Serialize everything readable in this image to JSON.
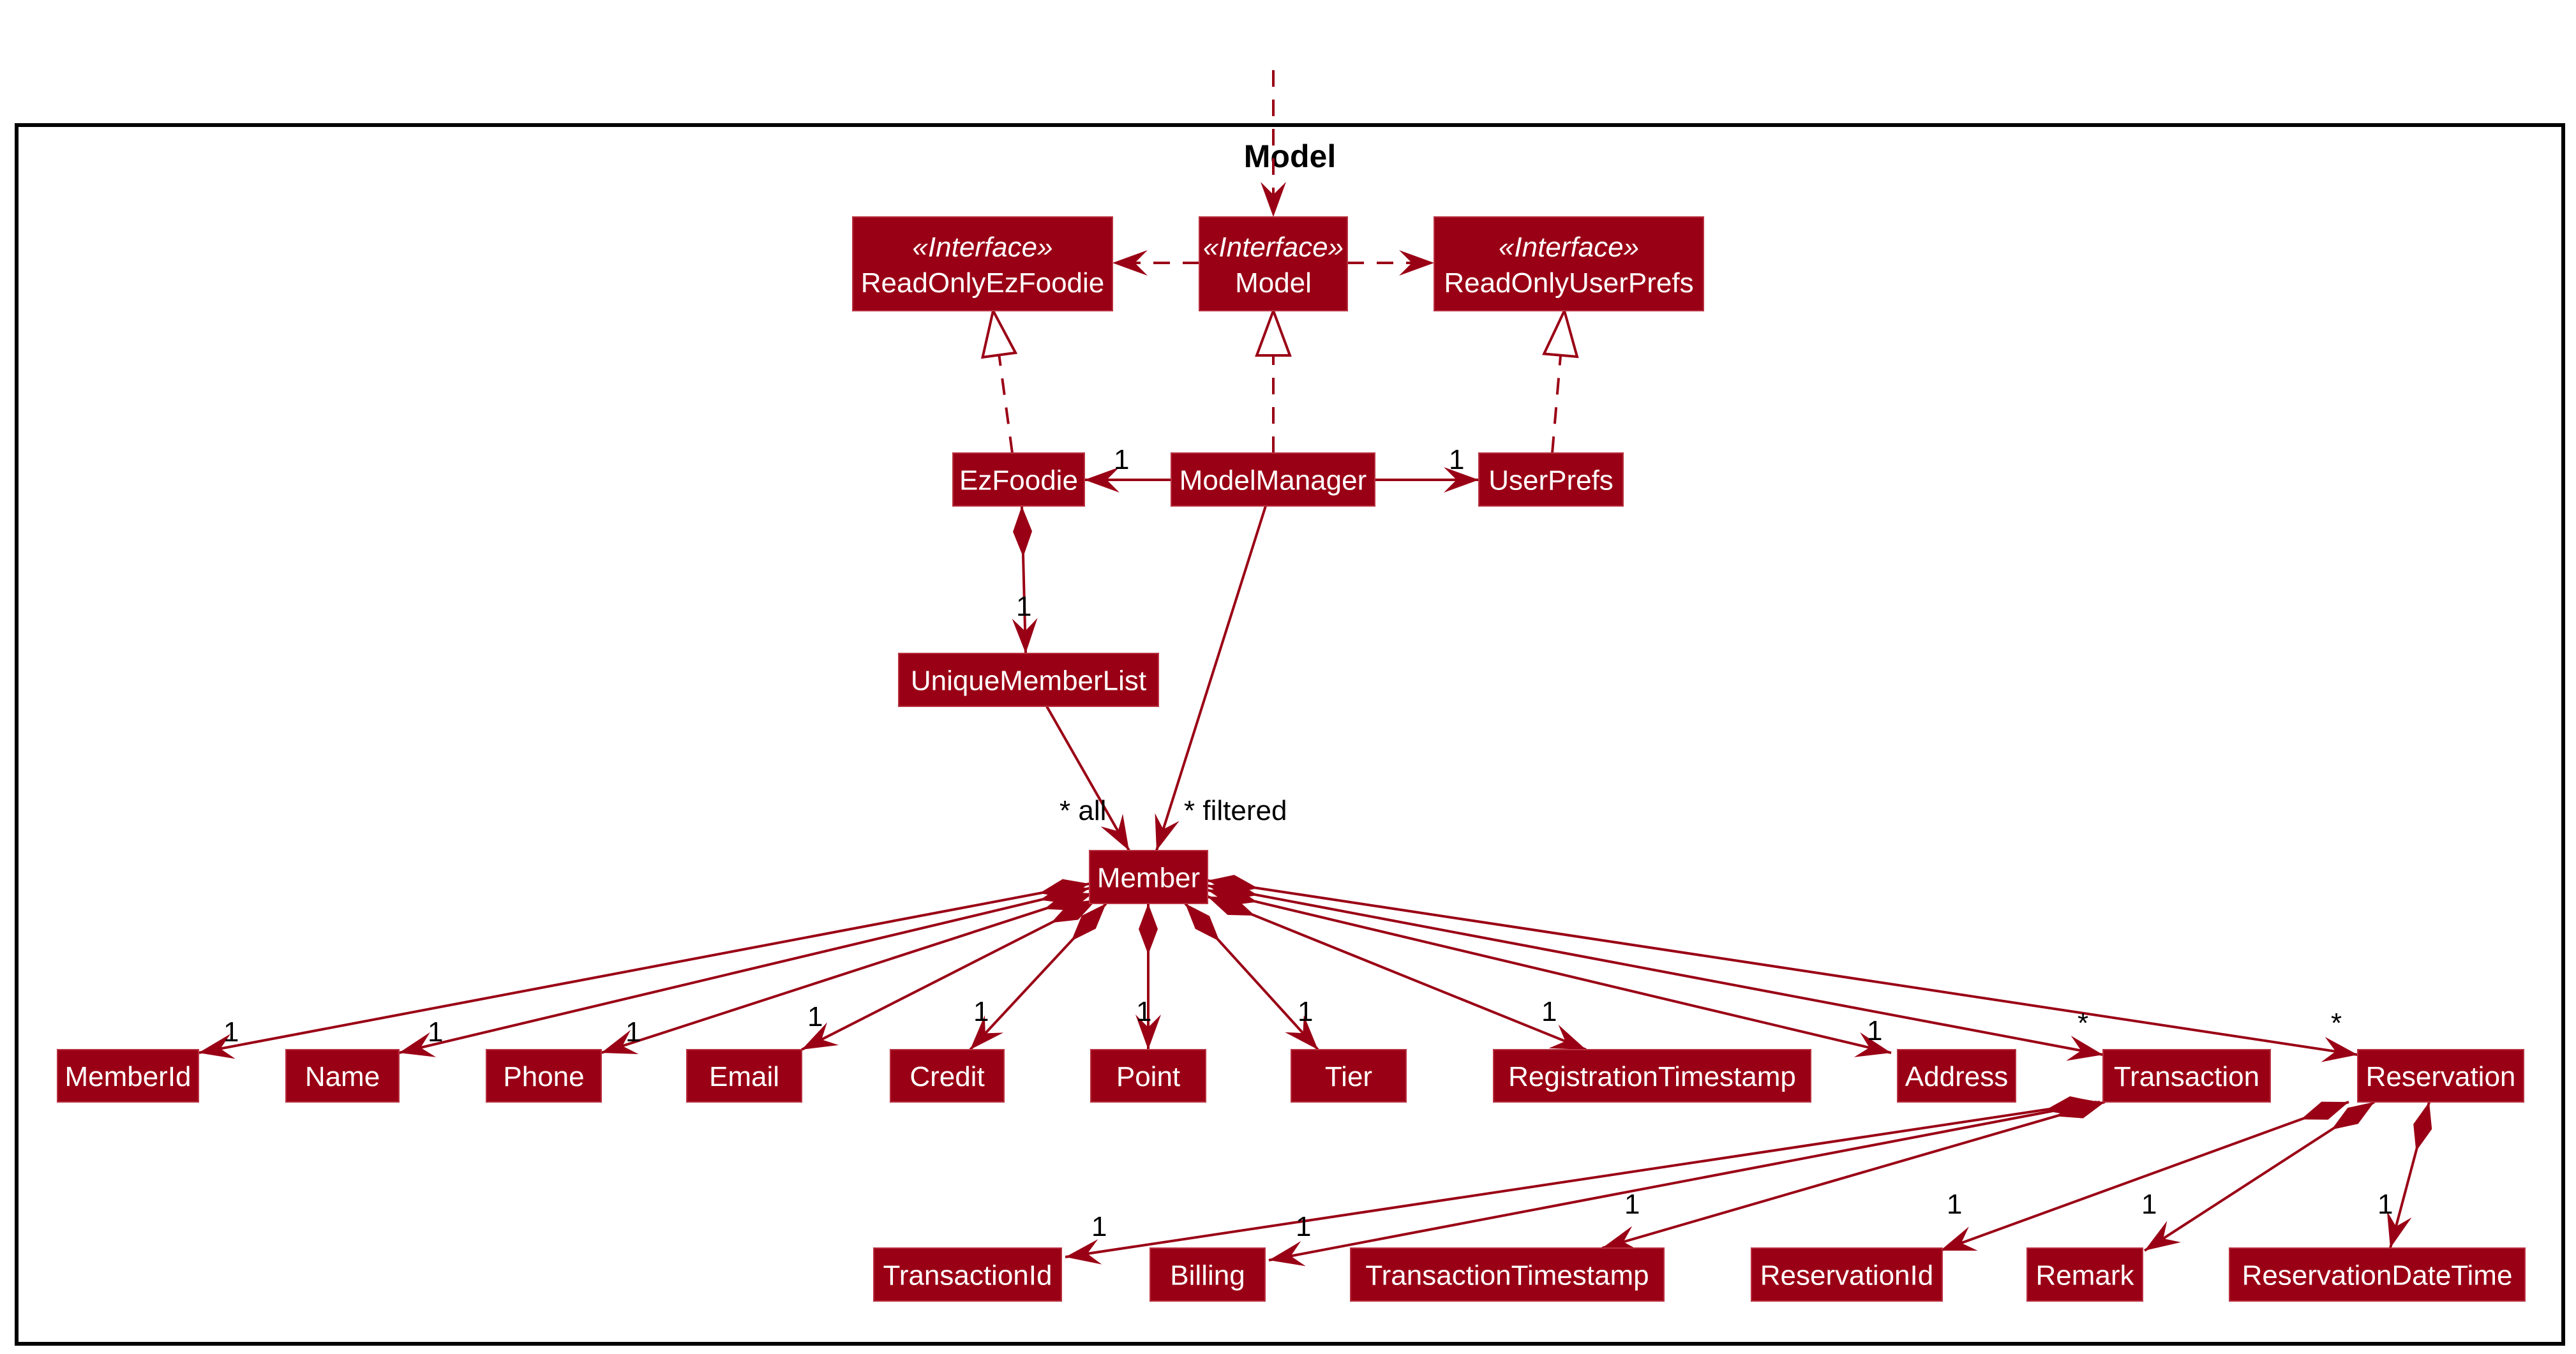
{
  "package": {
    "title": "Model"
  },
  "colors": {
    "box_fill": "#9a0015",
    "line": "#9a0015",
    "text_on_box": "#ffffff",
    "frame": "#000000"
  },
  "classes": {
    "ReadOnlyEzFoodie": {
      "stereotype": "«Interface»",
      "name": "ReadOnlyEzFoodie"
    },
    "ModelIface": {
      "stereotype": "«Interface»",
      "name": "Model"
    },
    "ReadOnlyUserPrefs": {
      "stereotype": "«Interface»",
      "name": "ReadOnlyUserPrefs"
    },
    "EzFoodie": {
      "name": "EzFoodie"
    },
    "ModelManager": {
      "name": "ModelManager"
    },
    "UserPrefs": {
      "name": "UserPrefs"
    },
    "UniqueMemberList": {
      "name": "UniqueMemberList"
    },
    "Member": {
      "name": "Member"
    },
    "MemberId": {
      "name": "MemberId"
    },
    "Name": {
      "name": "Name"
    },
    "Phone": {
      "name": "Phone"
    },
    "Email": {
      "name": "Email"
    },
    "Credit": {
      "name": "Credit"
    },
    "Point": {
      "name": "Point"
    },
    "Tier": {
      "name": "Tier"
    },
    "RegistrationTimestamp": {
      "name": "RegistrationTimestamp"
    },
    "Address": {
      "name": "Address"
    },
    "Transaction": {
      "name": "Transaction"
    },
    "Reservation": {
      "name": "Reservation"
    },
    "TransactionId": {
      "name": "TransactionId"
    },
    "Billing": {
      "name": "Billing"
    },
    "TransactionTimestamp": {
      "name": "TransactionTimestamp"
    },
    "ReservationId": {
      "name": "ReservationId"
    },
    "Remark": {
      "name": "Remark"
    },
    "ReservationDateTime": {
      "name": "ReservationDateTime"
    }
  },
  "relations": [
    {
      "from": "external",
      "to": "ModelIface",
      "type": "dependency",
      "label": ""
    },
    {
      "from": "ModelIface",
      "to": "ReadOnlyEzFoodie",
      "type": "dependency",
      "label": ""
    },
    {
      "from": "ModelIface",
      "to": "ReadOnlyUserPrefs",
      "type": "dependency",
      "label": ""
    },
    {
      "from": "EzFoodie",
      "to": "ReadOnlyEzFoodie",
      "type": "realization",
      "label": ""
    },
    {
      "from": "ModelManager",
      "to": "ModelIface",
      "type": "realization",
      "label": ""
    },
    {
      "from": "UserPrefs",
      "to": "ReadOnlyUserPrefs",
      "type": "realization",
      "label": ""
    },
    {
      "from": "ModelManager",
      "to": "EzFoodie",
      "type": "association",
      "label": "1"
    },
    {
      "from": "ModelManager",
      "to": "UserPrefs",
      "type": "association",
      "label": "1"
    },
    {
      "from": "EzFoodie",
      "to": "UniqueMemberList",
      "type": "composition",
      "label": "1"
    },
    {
      "from": "UniqueMemberList",
      "to": "Member",
      "type": "association",
      "label": "* all"
    },
    {
      "from": "ModelManager",
      "to": "Member",
      "type": "association",
      "label": "* filtered"
    },
    {
      "from": "Member",
      "to": "MemberId",
      "type": "composition",
      "label": "1"
    },
    {
      "from": "Member",
      "to": "Name",
      "type": "composition",
      "label": "1"
    },
    {
      "from": "Member",
      "to": "Phone",
      "type": "composition",
      "label": "1"
    },
    {
      "from": "Member",
      "to": "Email",
      "type": "composition",
      "label": "1"
    },
    {
      "from": "Member",
      "to": "Credit",
      "type": "composition",
      "label": "1"
    },
    {
      "from": "Member",
      "to": "Point",
      "type": "composition",
      "label": "1"
    },
    {
      "from": "Member",
      "to": "Tier",
      "type": "composition",
      "label": "1"
    },
    {
      "from": "Member",
      "to": "RegistrationTimestamp",
      "type": "composition",
      "label": "1"
    },
    {
      "from": "Member",
      "to": "Address",
      "type": "composition",
      "label": "1"
    },
    {
      "from": "Member",
      "to": "Transaction",
      "type": "composition",
      "label": "*"
    },
    {
      "from": "Member",
      "to": "Reservation",
      "type": "composition",
      "label": "*"
    },
    {
      "from": "Transaction",
      "to": "TransactionId",
      "type": "composition",
      "label": "1"
    },
    {
      "from": "Transaction",
      "to": "Billing",
      "type": "composition",
      "label": "1"
    },
    {
      "from": "Transaction",
      "to": "TransactionTimestamp",
      "type": "composition",
      "label": "1"
    },
    {
      "from": "Reservation",
      "to": "ReservationId",
      "type": "composition",
      "label": "1"
    },
    {
      "from": "Reservation",
      "to": "Remark",
      "type": "composition",
      "label": "1"
    },
    {
      "from": "Reservation",
      "to": "ReservationDateTime",
      "type": "composition",
      "label": "1"
    }
  ]
}
